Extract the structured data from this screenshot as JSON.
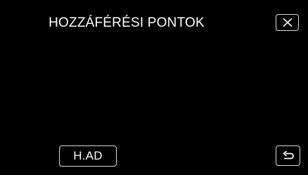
{
  "header": {
    "title": "HOZZÁFÉRÉSI PONTOK"
  },
  "buttons": {
    "close_icon": "close-icon",
    "back_icon": "return-icon",
    "had_label": "H.AD"
  },
  "colors": {
    "background": "#000000",
    "text": "#ffffff",
    "button_border": "#d8d8d8"
  }
}
